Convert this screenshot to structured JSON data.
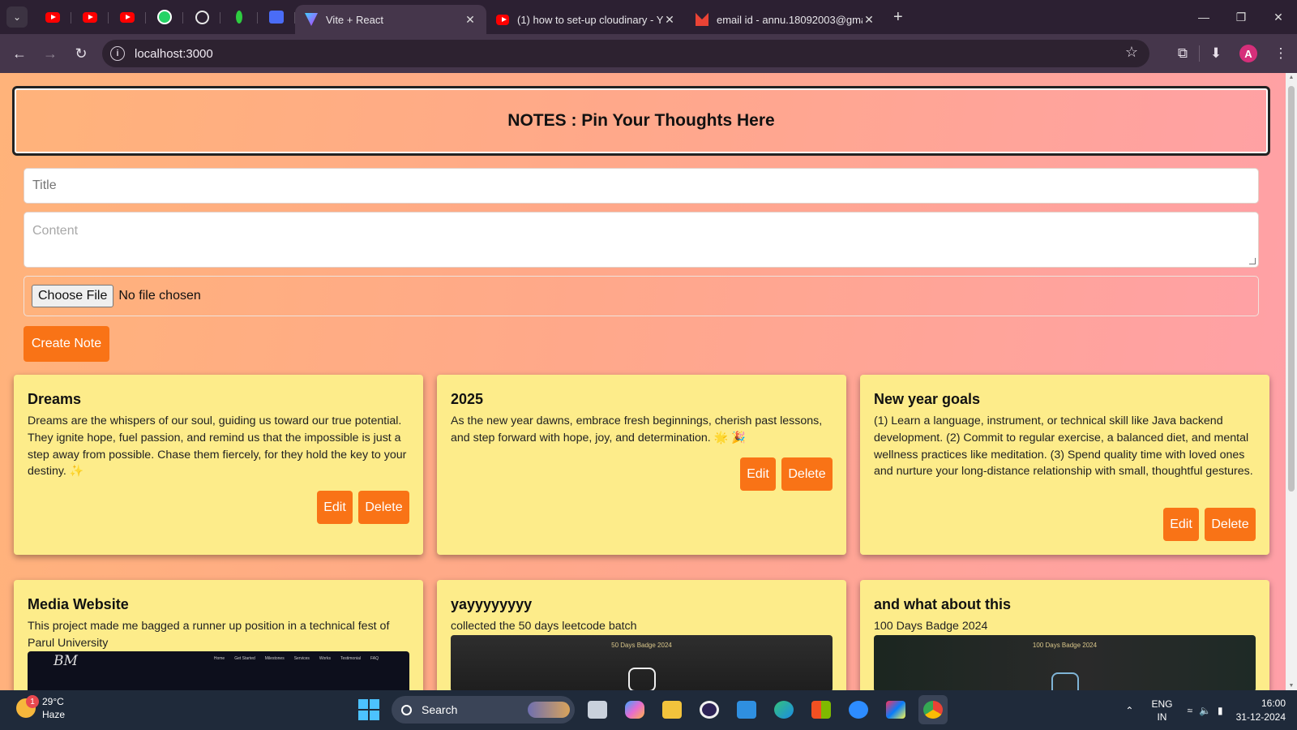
{
  "browser": {
    "tab_menu_icon": "chevron-down-icon",
    "pinned_tabs": [
      "youtube-icon",
      "youtube-icon",
      "youtube-icon",
      "whatsapp-icon",
      "chatgpt-icon",
      "leaf-icon",
      "wifi-app-icon"
    ],
    "tabs": [
      {
        "title": "Vite + React",
        "favicon": "vite-icon",
        "active": true
      },
      {
        "title": "(1) how to set-up cloudinary - Y",
        "favicon": "youtube-icon",
        "active": false
      },
      {
        "title": "email id - annu.18092003@gma",
        "favicon": "gmail-icon",
        "active": false
      }
    ],
    "url": "localhost:3000",
    "profile_initial": "A"
  },
  "page": {
    "header": "NOTES : Pin Your Thoughts Here",
    "title_placeholder": "Title",
    "content_placeholder": "Content",
    "choose_file_label": "Choose File",
    "file_status": "No file chosen",
    "create_button": "Create Note",
    "edit_label": "Edit",
    "delete_label": "Delete",
    "notes": [
      {
        "title": "Dreams",
        "content": "Dreams are the whispers of our soul, guiding us toward our true potential. They ignite hope, fuel passion, and remind us that the impossible is just a step away from possible. Chase them fiercely, for they hold the key to your destiny. ✨"
      },
      {
        "title": "2025",
        "content": "As the new year dawns, embrace fresh beginnings, cherish past lessons, and step forward with hope, joy, and determination. 🌟 🎉"
      },
      {
        "title": "New year goals",
        "content": "(1) Learn a language, instrument, or technical skill like Java backend development. (2) Commit to regular exercise, a balanced diet, and mental wellness practices like meditation. (3) Spend quality time with loved ones and nurture your long-distance relationship with small, thoughtful gestures."
      },
      {
        "title": "Media Website",
        "content": "This project made me bagged a runner up position in a technical fest of Parul University"
      },
      {
        "title": "yayyyyyyyy",
        "content": "collected the 50 days leetcode batch"
      },
      {
        "title": "and what about this",
        "content": "100 Days Badge 2024"
      }
    ],
    "image_texts": {
      "media_logo": "BM",
      "media_nav": [
        "Home",
        "Get Started",
        "Milestones",
        "Services",
        "Works",
        "Testimonial",
        "FAQ"
      ],
      "badge_50": "50 Days Badge 2024",
      "badge_100": "100 Days Badge 2024"
    },
    "colors": {
      "accent": "#f97316",
      "card": "#fdec8a"
    }
  },
  "taskbar": {
    "temperature": "29°C",
    "weather": "Haze",
    "weather_notification": "1",
    "search_label": "Search",
    "language_line1": "ENG",
    "language_line2": "IN",
    "time": "16:00",
    "date": "31-12-2024"
  }
}
